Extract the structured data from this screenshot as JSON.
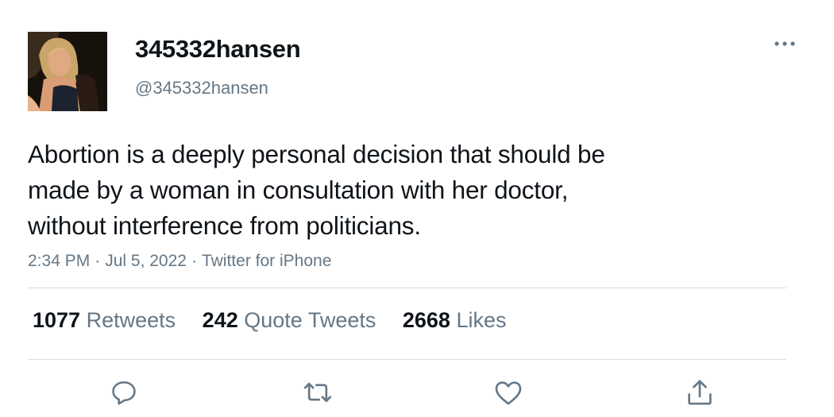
{
  "user": {
    "display_name": "345332hansen",
    "handle": "@345332hansen",
    "avatar": "profile-photo"
  },
  "tweet": {
    "text_lines": [
      "Abortion is a deeply personal decision that should be",
      "made by a woman in consultation with her doctor,",
      "without interference from politicians."
    ],
    "time": "2:34 PM",
    "date": "Jul 5, 2022",
    "source": "Twitter for iPhone",
    "separator": "·"
  },
  "stats": {
    "retweets_count": "1077",
    "retweets_label": "Retweets",
    "quotes_count": "242",
    "quotes_label": "Quote Tweets",
    "likes_count": "2668",
    "likes_label": "Likes"
  },
  "icons": {
    "more": "more-icon",
    "reply": "reply-icon",
    "retweet": "retweet-icon",
    "like": "like-icon",
    "share": "share-icon"
  },
  "colors": {
    "text": "#0f1419",
    "secondary": "#657786",
    "divider": "#d9dde1"
  }
}
